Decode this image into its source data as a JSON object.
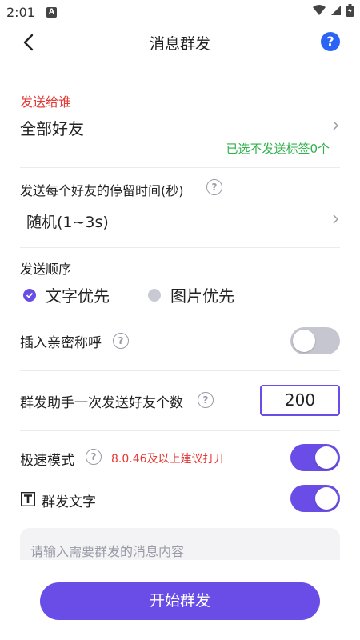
{
  "status_bar": {
    "time": "2:01",
    "notification_badge": "A",
    "icons": [
      "wifi-icon",
      "signal-icon",
      "battery-icon"
    ]
  },
  "header": {
    "title": "消息群发",
    "help": "?"
  },
  "send_to": {
    "label": "发送给谁",
    "value": "全部好友",
    "tag_status": "已选不发送标签0个"
  },
  "stay_time": {
    "label": "发送每个好友的停留时间(秒)",
    "value": "随机(1~3s)"
  },
  "send_order": {
    "label": "发送顺序",
    "options": [
      {
        "label": "文字优先",
        "checked": true
      },
      {
        "label": "图片优先",
        "checked": false
      }
    ]
  },
  "insert_nickname": {
    "label": "插入亲密称呼",
    "enabled": false
  },
  "batch_count": {
    "label": "群发助手一次发送好友个数",
    "value": "200"
  },
  "speed_mode": {
    "label": "极速模式",
    "hint": "8.0.46及以上建议打开",
    "enabled": true
  },
  "group_text": {
    "label": "群发文字",
    "enabled": true
  },
  "message": {
    "placeholder": "请输入需要群发的消息内容"
  },
  "start_button": "开始群发",
  "colors": {
    "accent": "#6a4de6",
    "danger": "#e53935",
    "success": "#2fb14b",
    "help": "#2b64f5"
  }
}
